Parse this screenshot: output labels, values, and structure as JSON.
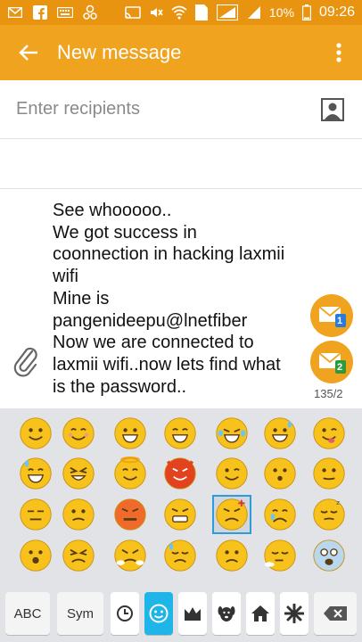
{
  "status_bar": {
    "battery_percent": "10%",
    "time": "09:26",
    "sim_badge": "1"
  },
  "app_bar": {
    "title": "New message"
  },
  "recipients": {
    "placeholder": "Enter recipients"
  },
  "compose": {
    "message": "See whooooo..\nWe got success in\ncoonnection in hacking laxmii\nwifi\nMine is\npangenideepu@lnetfiber\nNow we are connected to\nlaxmii wifi..now lets find what\nis the password..",
    "char_count": "135/2",
    "sim1_label": "1",
    "sim2_label": "2"
  },
  "keyboard": {
    "abc_label": "ABC",
    "sym_label": "Sym"
  },
  "colors": {
    "status_bar": "#e89410",
    "app_bar": "#f0a31e",
    "accent_blue": "#1fb5e8",
    "emoji_yellow": "#f7c21c"
  }
}
